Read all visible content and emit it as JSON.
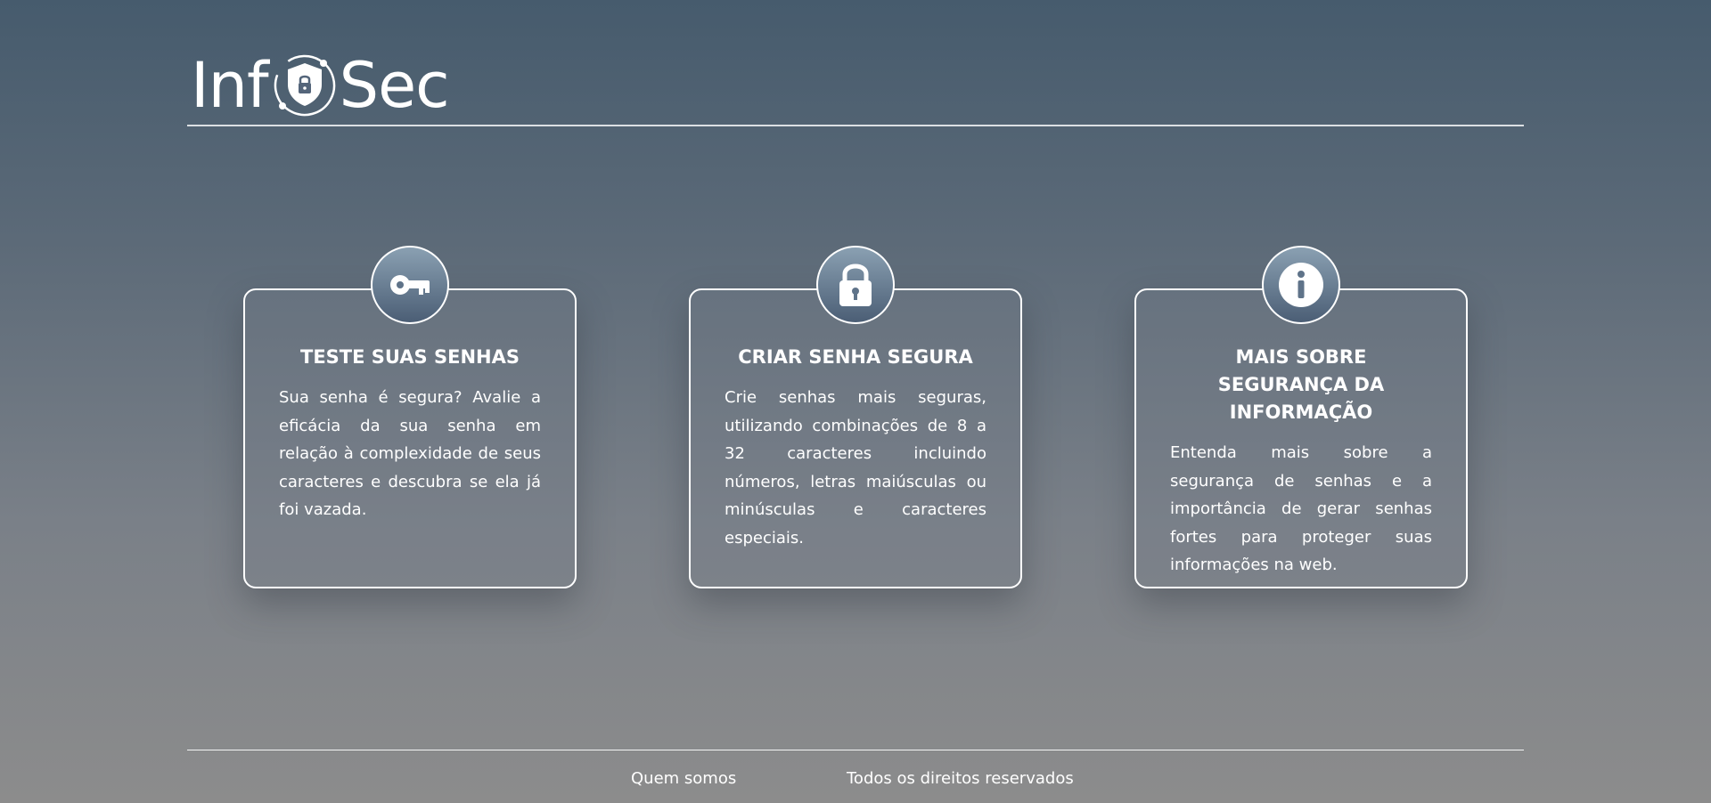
{
  "header": {
    "logo_left": "Inf",
    "logo_right": "Sec"
  },
  "cards": [
    {
      "icon": "key-icon",
      "title": "TESTE SUAS SENHAS",
      "text": "Sua senha é segura? Avalie a eficácia da sua senha em relação à complexidade de seus caracteres e descubra se ela já foi vazada."
    },
    {
      "icon": "padlock-icon",
      "title": "CRIAR SENHA SEGURA",
      "text": "Crie senhas mais seguras, utilizando combinações de 8 a 32 caracteres incluindo números, letras maiúsculas ou minúsculas e caracteres especiais."
    },
    {
      "icon": "info-icon",
      "title": "MAIS SOBRE SEGURANÇA DA INFORMAÇÃO",
      "text": "Entenda mais sobre a segurança de senhas e a importância de gerar senhas fortes para proteger suas informações na web."
    }
  ],
  "footer": {
    "about_link": "Quem somos",
    "rights": "Todos os direitos reservados"
  },
  "colors": {
    "background_top": "#465b6d",
    "background_bottom": "#8c8c8c",
    "icon_gradient_top": "#8aa0b2",
    "icon_gradient_bottom": "#4b5e75",
    "text": "#ffffff"
  }
}
